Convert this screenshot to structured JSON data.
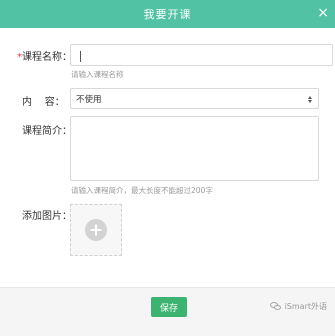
{
  "dialog": {
    "title": "我要开课",
    "close_icon": "×"
  },
  "form": {
    "course_name": {
      "required_mark": "*",
      "label": "课程名称：",
      "value": "",
      "hint": "请输入课程名称"
    },
    "content": {
      "label": "内    容：",
      "selected": "不使用"
    },
    "intro": {
      "label": "课程简介：",
      "value": "",
      "hint": "请输入课程简介，最大长度不能超过200字"
    },
    "image": {
      "label": "添加图片："
    }
  },
  "footer": {
    "save_label": "保存",
    "watermark": "iSmart外语"
  },
  "colors": {
    "header": "#52c2a4",
    "save_button": "#3cb371",
    "required": "#e33c3c"
  }
}
